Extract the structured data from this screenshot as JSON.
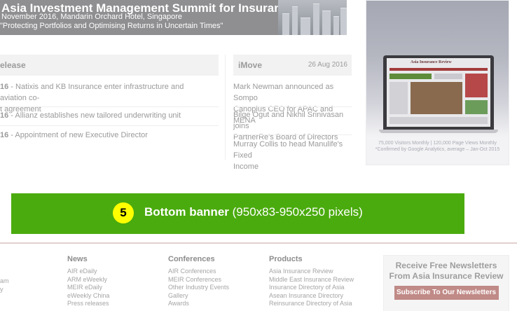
{
  "summit": {
    "title": "Asia Investment Management Summit for Insurance",
    "date": "November 2016, Mandarin Orchard Hotel, Singapore",
    "tagline": "\"Protecting Portfolios and Optimising Returns in Uncertain Times\""
  },
  "press": {
    "header": "elease",
    "items": [
      {
        "date": "16",
        "sep": " - ",
        "text": "Natixis and KB Insurance enter infrastructure and aviation co-",
        "text2": "t agreement"
      },
      {
        "date": "16",
        "sep": " - ",
        "text": "Allianz establishes new tailored underwriting unit"
      },
      {
        "date": "16",
        "sep": " - ",
        "text": "Appointment of new Executive Director"
      }
    ]
  },
  "imove": {
    "header": "iMove",
    "date": "26 Aug 2016",
    "items": [
      {
        "line1": "Mark Newman announced as Sompo",
        "line2": "Canopius CEO for APAC and MENA"
      },
      {
        "line1": "Bilge Ogut and Nikhil Srinivasan joins",
        "line2": "PartnerRe's Board of Directors"
      },
      {
        "line1": "Murray Collis to head Manulife's Fixed",
        "line2": "Income"
      }
    ]
  },
  "side_ad": {
    "logo": "Asia Insurance Review",
    "stats_line1": "75,000 Visitors Monthly | 120,000 Page Views Monthly",
    "stats_line2": "*Confirmed by Google Analytics, average – Jan-Oct 2015"
  },
  "bottom_banner": {
    "number": "5",
    "label": "Bottom banner",
    "size": "(950x83-950x250 pixels)",
    "color": "#4aab0e"
  },
  "footer": {
    "edge_links": [
      "am",
      "y"
    ],
    "news": {
      "heading": "News",
      "links": [
        "AIR eDaily",
        "ARM eWeekly",
        "MEIR eDaily",
        "eWeekly China",
        "Press releases"
      ]
    },
    "conferences": {
      "heading": "Conferences",
      "links": [
        "AIR Conferences",
        "MEIR Conferences",
        "Other Industry Events",
        "Gallery",
        "Awards"
      ]
    },
    "products": {
      "heading": "Products",
      "links": [
        "Asia Insurance Review",
        "Middle East Insurance Review",
        "Insurance Directory of Asia",
        "Asean Insurance Directory",
        "Reinsurance Directory of Asia"
      ]
    },
    "newsletter": {
      "title_line1": "Receive Free Newsletters",
      "title_line2": "From Asia Insurance Review",
      "button": "Subscribe To Our Newsletters"
    }
  }
}
